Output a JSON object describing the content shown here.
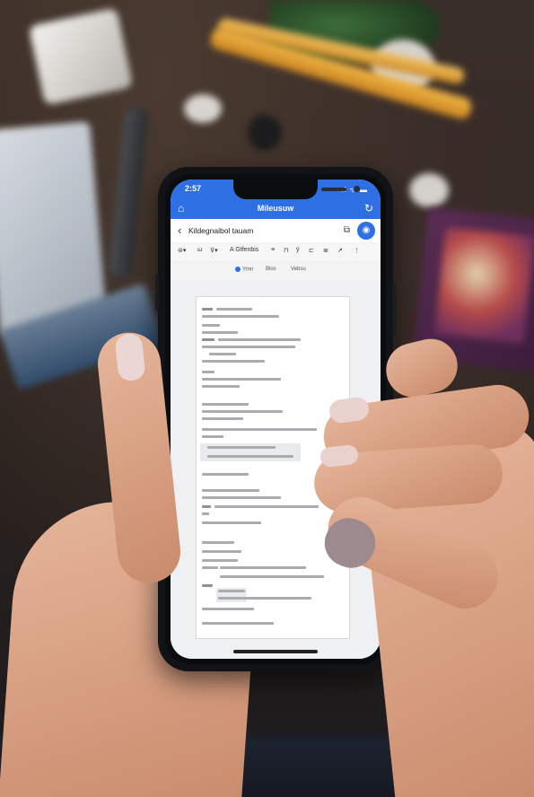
{
  "status_bar": {
    "time": "2:57",
    "indicators": "ıl ᯤ ▬"
  },
  "app_bar": {
    "title": "Mileusuw",
    "left_icon": "home-icon",
    "right_icon": "refresh-icon"
  },
  "document_bar": {
    "back_icon": "back-chevron-icon",
    "title": "Kildegnaibol tauam",
    "share_icon": "share-icon",
    "fab_icon": "assistant-icon"
  },
  "toolbar": {
    "items": [
      "⊜▾",
      "ω",
      "⊽▾",
      "A Gtfenbis",
      "≡",
      "⊓",
      "ÿ",
      "⊏",
      "≣",
      "↗",
      "⋮"
    ]
  },
  "tab_row": {
    "tabs": [
      "Ymn",
      "Blos",
      "Vebsu"
    ]
  },
  "colors": {
    "accent": "#2f6fe4",
    "page_background": "#ffffff",
    "canvas": "#eef0f2"
  }
}
